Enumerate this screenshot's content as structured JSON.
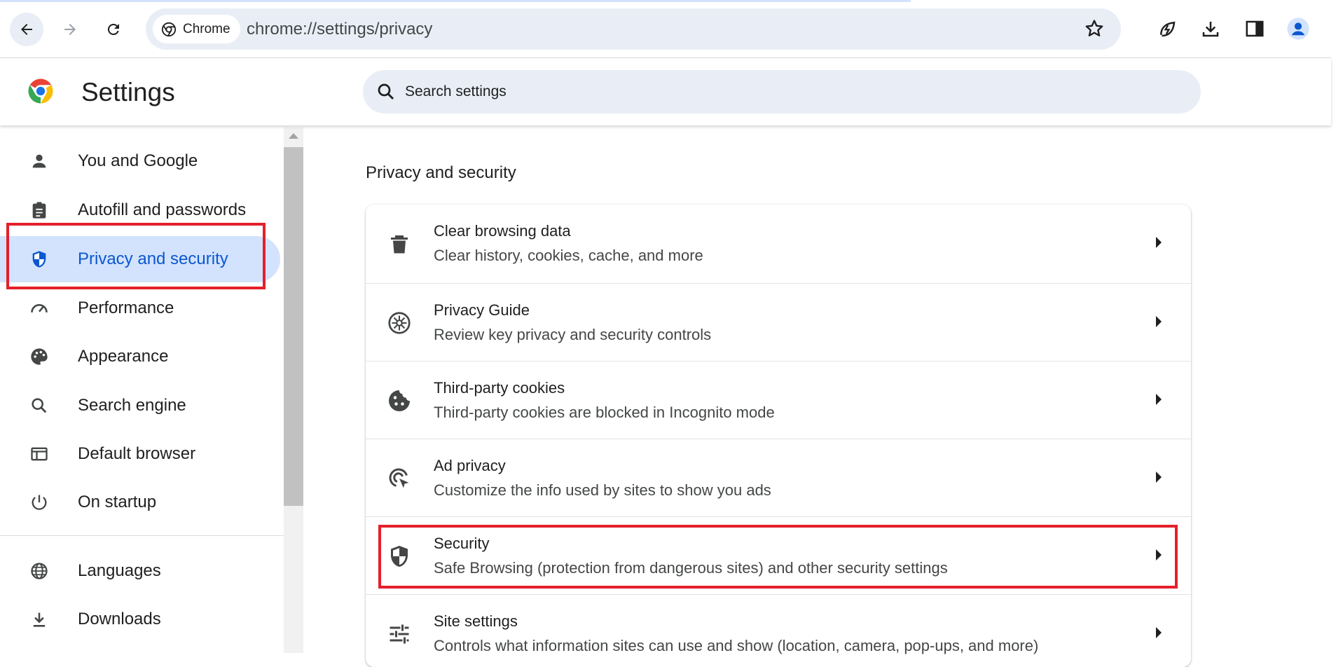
{
  "browser": {
    "chip_label": "Chrome",
    "url": "chrome://settings/privacy"
  },
  "header": {
    "title": "Settings",
    "search_placeholder": "Search settings"
  },
  "sidebar": {
    "items": [
      {
        "label": "You and Google",
        "icon": "person-icon"
      },
      {
        "label": "Autofill and passwords",
        "icon": "clipboard-icon"
      },
      {
        "label": "Privacy and security",
        "icon": "shield-icon",
        "active": true
      },
      {
        "label": "Performance",
        "icon": "speedometer-icon"
      },
      {
        "label": "Appearance",
        "icon": "palette-icon"
      },
      {
        "label": "Search engine",
        "icon": "search-icon"
      },
      {
        "label": "Default browser",
        "icon": "browser-window-icon"
      },
      {
        "label": "On startup",
        "icon": "power-icon"
      },
      {
        "label": "Languages",
        "icon": "globe-icon"
      },
      {
        "label": "Downloads",
        "icon": "download-icon"
      }
    ]
  },
  "main": {
    "section_title": "Privacy and security",
    "rows": [
      {
        "title": "Clear browsing data",
        "subtitle": "Clear history, cookies, cache, and more",
        "icon": "trash-icon"
      },
      {
        "title": "Privacy Guide",
        "subtitle": "Review key privacy and security controls",
        "icon": "compass-icon"
      },
      {
        "title": "Third-party cookies",
        "subtitle": "Third-party cookies are blocked in Incognito mode",
        "icon": "cookie-icon"
      },
      {
        "title": "Ad privacy",
        "subtitle": "Customize the info used by sites to show you ads",
        "icon": "ad-privacy-icon"
      },
      {
        "title": "Security",
        "subtitle": "Safe Browsing (protection from dangerous sites) and other security settings",
        "icon": "security-shield-icon"
      },
      {
        "title": "Site settings",
        "subtitle": "Controls what information sites can use and show (location, camera, pop-ups, and more)",
        "icon": "sliders-icon"
      }
    ]
  },
  "colors": {
    "accent": "#0b57d0",
    "active_bg": "#d3e3fd",
    "highlight": "#e3202b"
  }
}
